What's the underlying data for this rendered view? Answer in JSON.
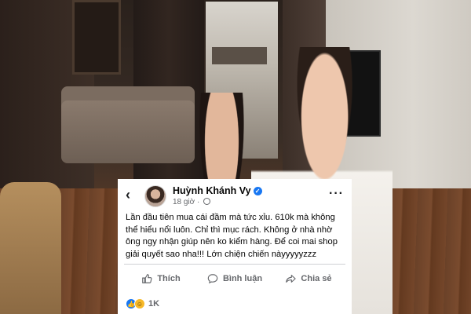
{
  "post": {
    "author_name": "Huỳnh Khánh Vy",
    "timestamp": "18 giờ",
    "verified_icon": "verified-badge-icon",
    "privacy_icon": "globe-icon",
    "body_text": "Lần đầu tiên mua cái đầm mà tức xỉu. 610k mà không thể hiểu nổi luôn. Chỉ thì mục rách. Không ở nhà nhờ ông ngy nhận giúp nên ko kiểm hàng. Để coi mai shop giải quyết sao nha!!! Lớn chiện chiến nàyyyyyzzz",
    "actions": {
      "like_label": "Thích",
      "comment_label": "Bình luận",
      "share_label": "Chia sẻ"
    },
    "reactions": {
      "count": "1K",
      "types": [
        "like",
        "haha"
      ]
    },
    "colors": {
      "brand_blue": "#1877f2",
      "secondary_text": "#65676b",
      "primary_text": "#050505"
    }
  }
}
